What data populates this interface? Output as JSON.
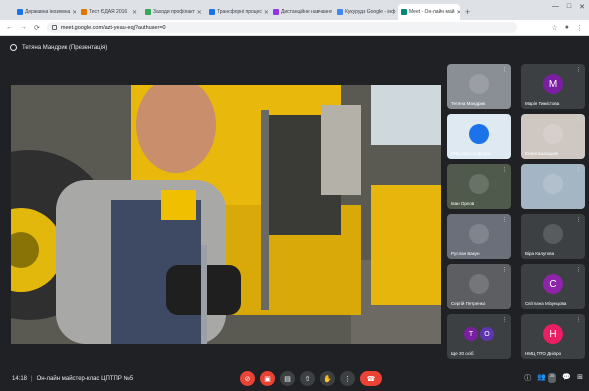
{
  "browser": {
    "tabs": [
      {
        "title": "Державна іноземна",
        "color": "#1a73e8"
      },
      {
        "title": "Тест ЄДАЯ 2016",
        "color": "#e37400"
      },
      {
        "title": "Заходи профілакт",
        "color": "#34a853"
      },
      {
        "title": "Трансфорні процес",
        "color": "#1a73e8"
      },
      {
        "title": "Дистанційне навчання",
        "color": "#9334e6"
      },
      {
        "title": "Кукурудз Google - інф",
        "color": "#4285f4"
      },
      {
        "title": "Meet - Он-лайн май",
        "color": "#00897b"
      }
    ],
    "url": "meet.google.com/azt-yeau-eqj?authuser=0"
  },
  "meet": {
    "presenter_label": "Тетяна Мандрик (Презентація)",
    "clock": "14:18",
    "meeting_title": "Он-лайн майстер-клас ЦПТПР №5",
    "participants_count": "25",
    "tiles": [
      {
        "name": "Тетяна Мандрик",
        "type": "photo",
        "photo_color": "#8a8f96"
      },
      {
        "name": "Марія Тимістова",
        "type": "avatar",
        "letter": "M",
        "color": "#7b1fa2"
      },
      {
        "name": "РПЦ №12 м.Дніпро",
        "type": "logo",
        "photo_color": "#dfe9f2"
      },
      {
        "name": "Юлия Балацкая",
        "type": "photo",
        "photo_color": "#cfc7c2"
      },
      {
        "name": "Іван Орлов",
        "type": "photo",
        "photo_color": "#4f5a4c"
      },
      {
        "name": "",
        "type": "photo",
        "photo_color": "#a4b6c4"
      },
      {
        "name": "Руслан Бакун",
        "type": "photo",
        "photo_color": "#6a6f7a"
      },
      {
        "name": "Віра Калугова",
        "type": "photo",
        "photo_color": "#3c4043"
      },
      {
        "name": "Сергій Петренко",
        "type": "photo",
        "photo_color": "#5d5e62"
      },
      {
        "name": "Світлана Мізунцова",
        "type": "avatar",
        "letter": "C",
        "color": "#8e24aa"
      },
      {
        "name": "Ще 20 осіб",
        "type": "group",
        "letters": [
          "T",
          "O"
        ],
        "colors": [
          "#7b1fa2",
          "#5e35b1"
        ]
      },
      {
        "name": "НМЦ ПТО Дніпро",
        "type": "avatar",
        "letter": "H",
        "color": "#e91e63"
      }
    ]
  },
  "colors": {
    "hangup": "#ea4335",
    "meet_bg": "#202124",
    "tile_bg": "#3c4043"
  }
}
